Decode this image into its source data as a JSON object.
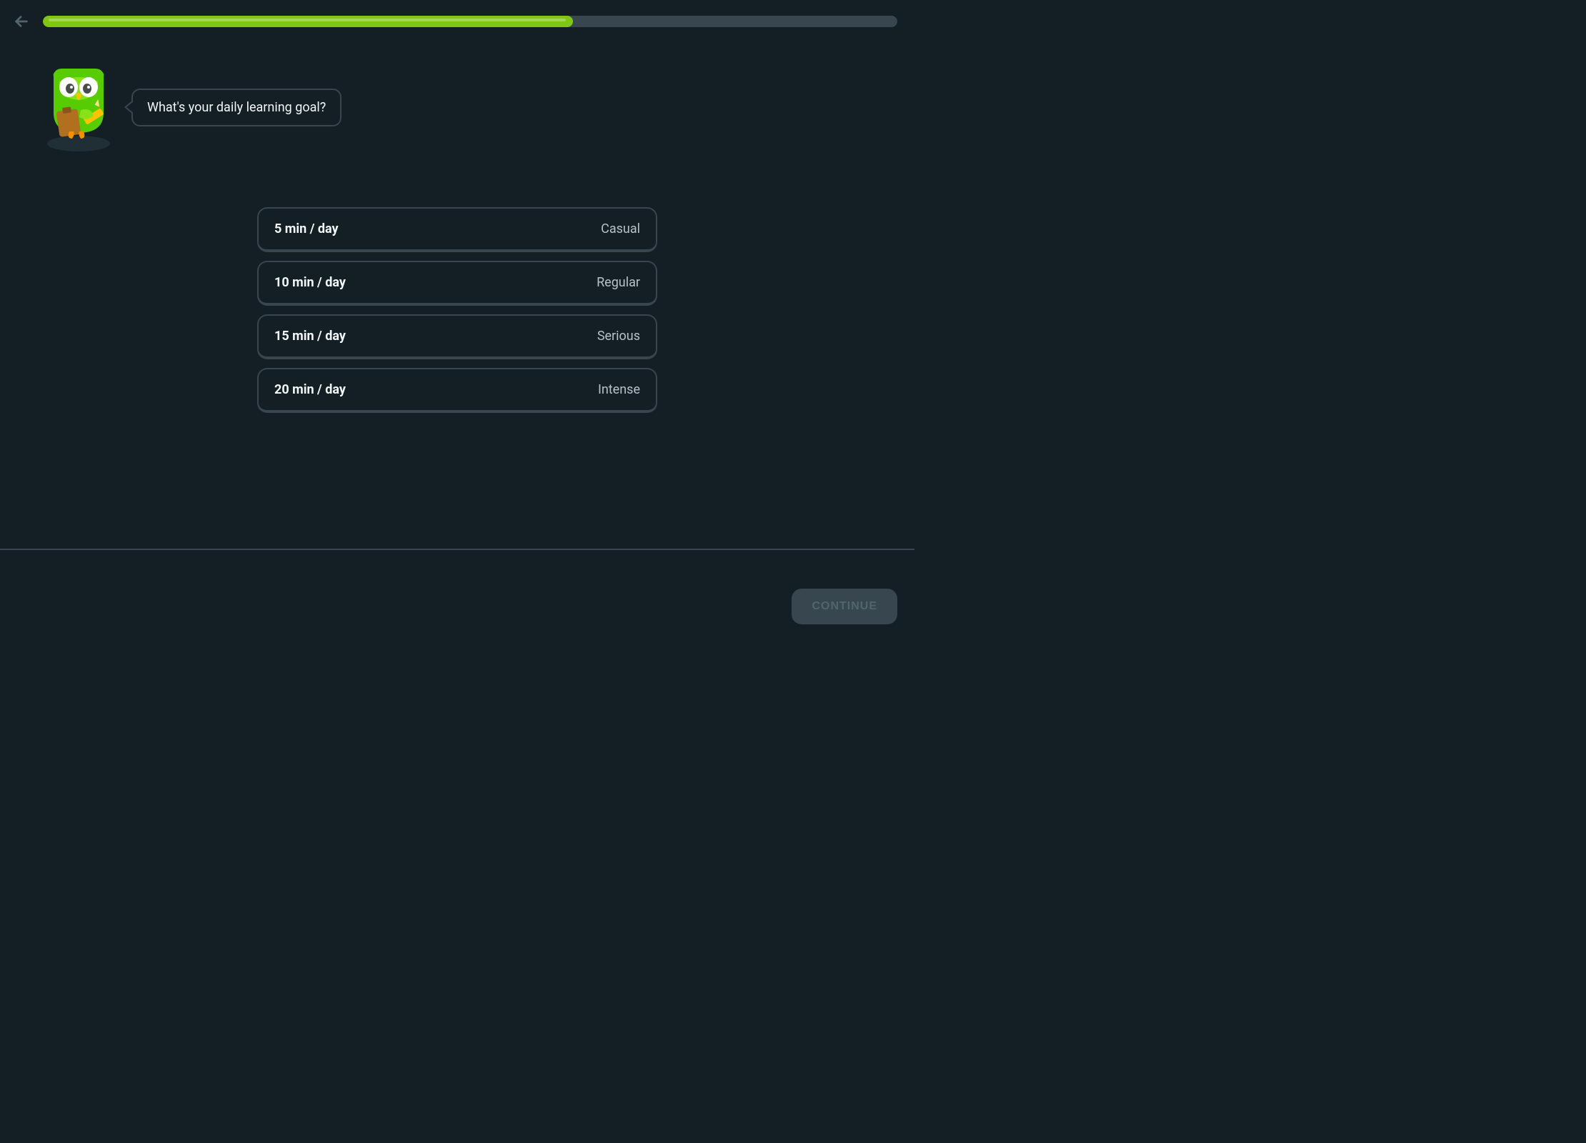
{
  "progress": {
    "percent": 62
  },
  "mascot": {
    "prompt": "What's your daily learning goal?"
  },
  "options": [
    {
      "duration": "5 min / day",
      "label": "Casual"
    },
    {
      "duration": "10 min / day",
      "label": "Regular"
    },
    {
      "duration": "15 min / day",
      "label": "Serious"
    },
    {
      "duration": "20 min / day",
      "label": "Intense"
    }
  ],
  "footer": {
    "continue_label": "CONTINUE"
  }
}
